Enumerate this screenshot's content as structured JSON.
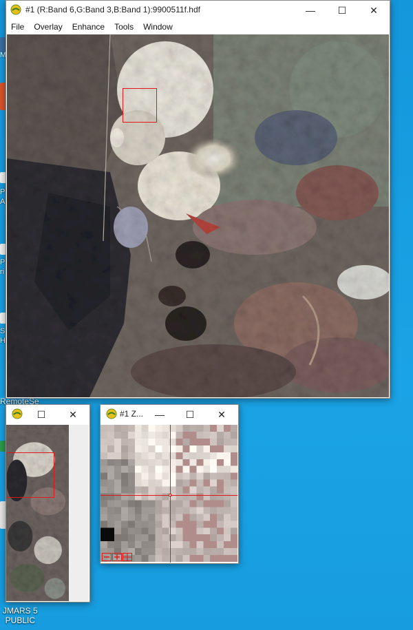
{
  "desktop": {
    "icon_labels": [
      "M",
      "P\nA",
      "P\nri",
      "S\nH"
    ],
    "remotese_label": "RemoteSe",
    "jmars_label": "JMARS 5\nPUBLIC"
  },
  "main_window": {
    "title": "#1 (R:Band 6,G:Band 3,B:Band 1):9900511f.hdf",
    "menu": [
      "File",
      "Overlay",
      "Enhance",
      "Tools",
      "Window"
    ],
    "minimize_glyph": "—",
    "maximize_glyph": "☐",
    "close_glyph": "✕"
  },
  "scroll_window": {
    "title": "",
    "minimize_glyph": "—",
    "maximize_glyph": "☐",
    "close_glyph": "✕"
  },
  "zoom_window": {
    "title": "#1 Z...",
    "minimize_glyph": "—",
    "maximize_glyph": "☐",
    "close_glyph": "✕",
    "zoom_controls": [
      "minus-icon",
      "plus-icon",
      "grid-icon"
    ]
  },
  "colors": {
    "desktop_blue": "#1a9fe0",
    "roi_red": "#e01818"
  }
}
